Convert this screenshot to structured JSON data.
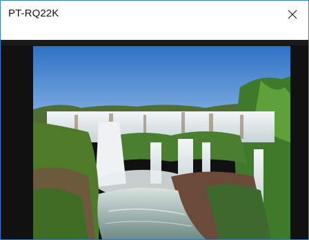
{
  "window": {
    "title": "PT-RQ22K",
    "close_icon": "close-icon",
    "border_color": "#2b7fd4"
  },
  "preview": {
    "image_icon": "waterfall-photo",
    "background_color": "#111111"
  }
}
